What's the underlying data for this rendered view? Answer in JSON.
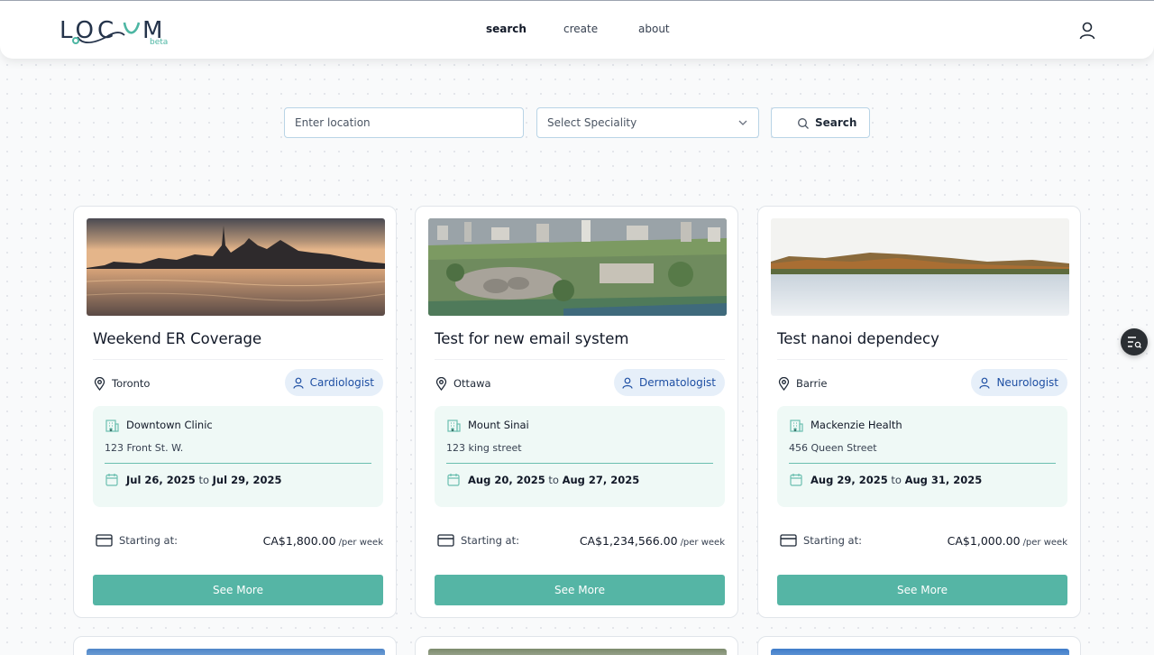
{
  "header": {
    "logo_text": "LOCUM",
    "logo_badge": "beta",
    "nav": [
      {
        "label": "search",
        "active": true
      },
      {
        "label": "create",
        "active": false
      },
      {
        "label": "about",
        "active": false
      }
    ],
    "user_icon": "user-icon"
  },
  "search": {
    "location_placeholder": "Enter location",
    "speciality_placeholder": "Select Speciality",
    "button_label": "Search"
  },
  "listings": [
    {
      "title": "Weekend ER Coverage",
      "city": "Toronto",
      "speciality": "Cardiologist",
      "clinic": "Downtown Clinic",
      "address": "123 Front St. W.",
      "start_date": "Jul 26, 2025",
      "to_label": "to",
      "end_date": "Jul 29, 2025",
      "starting_label": "Starting at:",
      "price": "CA$1,800.00",
      "per": "/per week",
      "button": "See More",
      "image": "city-skyline-sunset"
    },
    {
      "title": "Test for new email system",
      "city": "Ottawa",
      "speciality": "Dermatologist",
      "clinic": "Mount Sinai",
      "address": "123 king street",
      "start_date": "Aug 20, 2025",
      "to_label": "to",
      "end_date": "Aug 27, 2025",
      "starting_label": "Starting at:",
      "price": "CA$1,234,566.00",
      "per": "/per week",
      "button": "See More",
      "image": "city-aerial"
    },
    {
      "title": "Test nanoi dependecy",
      "city": "Barrie",
      "speciality": "Neurologist",
      "clinic": "Mackenzie Health",
      "address": "456 Queen Street",
      "start_date": "Aug 29, 2025",
      "to_label": "to",
      "end_date": "Aug 31, 2025",
      "starting_label": "Starting at:",
      "price": "CA$1,000.00",
      "per": "/per week",
      "button": "See More",
      "image": "lake-autumn-hills"
    }
  ],
  "colors": {
    "accent": "#55b5a5",
    "badge_bg": "#e6eff9",
    "badge_text": "#1e4fa3",
    "clinic_bg": "#eff9f6"
  },
  "fab_icon": "filter-list-icon"
}
